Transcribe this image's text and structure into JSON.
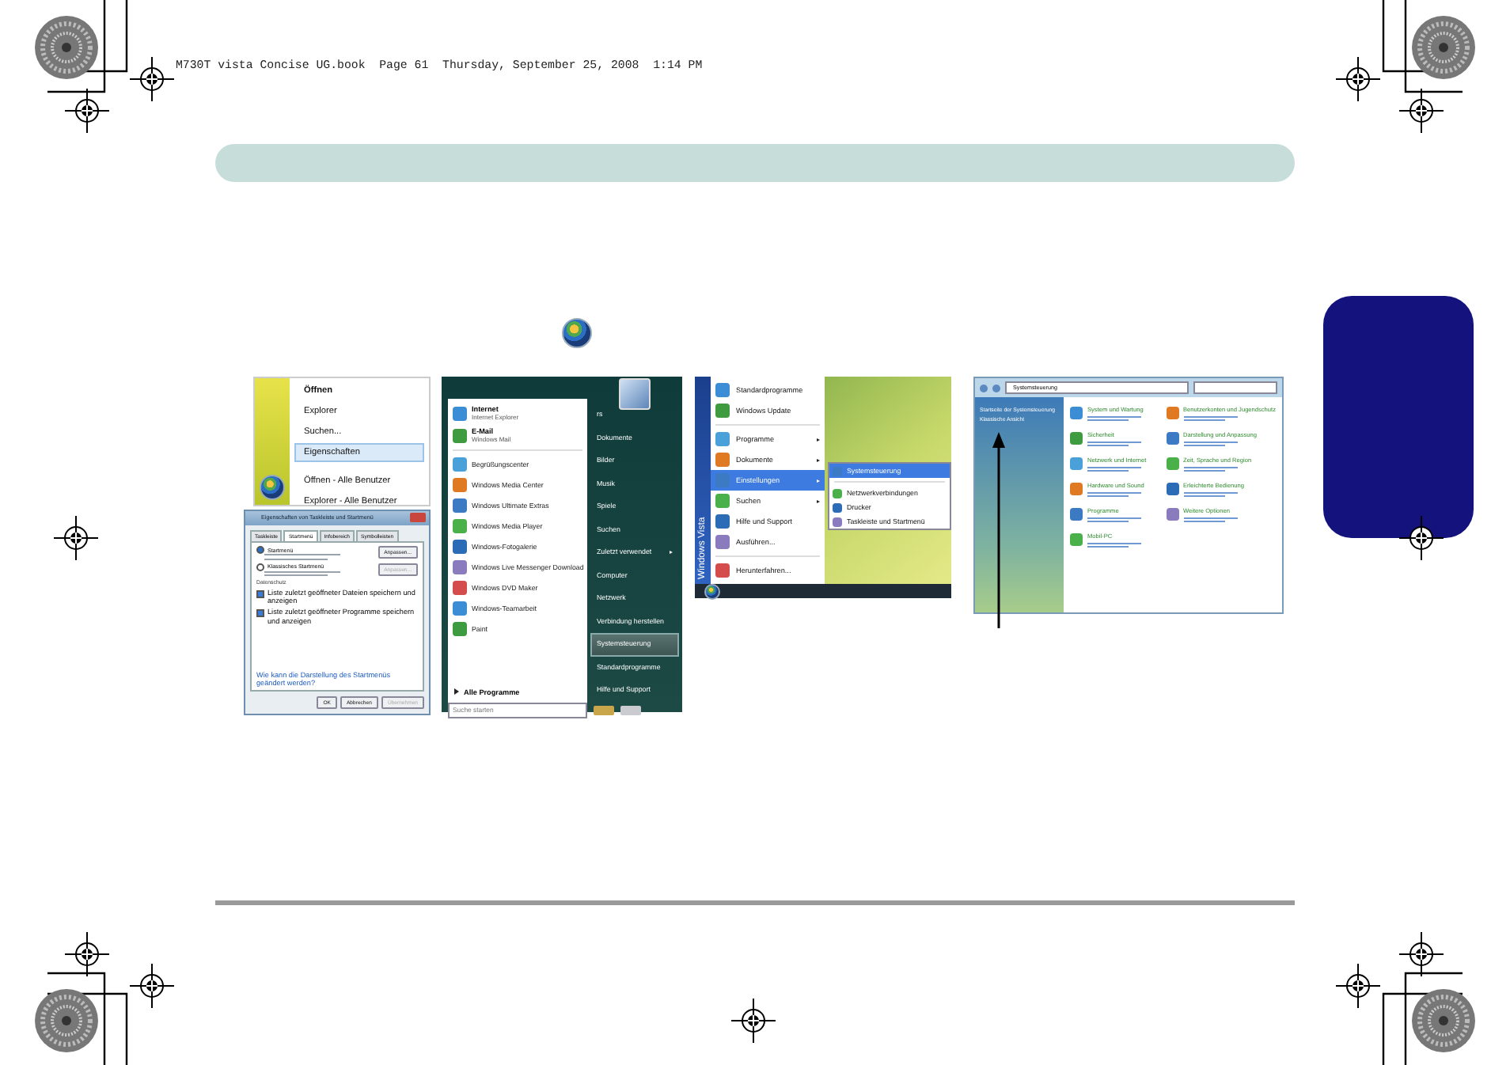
{
  "header": {
    "text": "M730T vista Concise UG.book  Page 61  Thursday, September 25, 2008  1:14 PM"
  },
  "context_menu": {
    "items": [
      {
        "label": "Öffnen",
        "bold": true,
        "selected": false
      },
      {
        "label": "Explorer",
        "bold": false,
        "selected": false
      },
      {
        "label": "Suchen...",
        "bold": false,
        "selected": false
      },
      {
        "label": "Eigenschaften",
        "bold": false,
        "selected": true
      },
      {
        "label": "Öffnen - Alle Benutzer",
        "bold": false,
        "selected": false
      },
      {
        "label": "Explorer - Alle Benutzer",
        "bold": false,
        "selected": false
      }
    ]
  },
  "properties_dialog": {
    "title": "Eigenschaften von Taskleiste und Startmenü",
    "tabs": [
      {
        "label": "Taskleiste",
        "selected": false
      },
      {
        "label": "Startmenü",
        "selected": true
      },
      {
        "label": "Infobereich",
        "selected": false
      },
      {
        "label": "Symbolleisten",
        "selected": false
      }
    ],
    "options": [
      {
        "label": "Startmenü",
        "selected": true,
        "button": "Anpassen...",
        "disabled": false
      },
      {
        "label": "Klassisches Startmenü",
        "selected": false,
        "button": "Anpassen...",
        "disabled": true
      }
    ],
    "privacy": {
      "label": "Datenschutz",
      "checks": [
        {
          "label": "Liste zuletzt geöffneter Dateien speichern und anzeigen",
          "checked": true
        },
        {
          "label": "Liste zuletzt geöffneter Programme speichern und anzeigen",
          "checked": true
        }
      ]
    },
    "link": "Wie kann die Darstellung des Startmenüs geändert werden?",
    "buttons": [
      {
        "label": "OK",
        "disabled": false
      },
      {
        "label": "Abbrechen",
        "disabled": false
      },
      {
        "label": "Übernehmen",
        "disabled": true
      }
    ]
  },
  "start_menu": {
    "pinned": [
      {
        "title": "Internet",
        "subtitle": "Internet Explorer"
      },
      {
        "title": "E-Mail",
        "subtitle": "Windows Mail"
      }
    ],
    "programs": [
      "Begrüßungscenter",
      "Windows Media Center",
      "Windows Ultimate Extras",
      "Windows Media Player",
      "Windows-Fotogalerie",
      "Windows Live Messenger Download",
      "Windows DVD Maker",
      "Windows-Teamarbeit",
      "Paint"
    ],
    "all_programs": "Alle Programme",
    "search": {
      "placeholder": "Suche starten"
    },
    "places": [
      {
        "label": "rs",
        "submenu": false,
        "selected": false
      },
      {
        "label": "Dokumente",
        "submenu": false,
        "selected": false
      },
      {
        "label": "Bilder",
        "submenu": false,
        "selected": false
      },
      {
        "label": "Musik",
        "submenu": false,
        "selected": false
      },
      {
        "label": "Spiele",
        "submenu": false,
        "selected": false
      },
      {
        "label": "Suchen",
        "submenu": false,
        "selected": false
      },
      {
        "label": "Zuletzt verwendet",
        "submenu": true,
        "selected": false
      },
      {
        "label": "Computer",
        "submenu": false,
        "selected": false
      },
      {
        "label": "Netzwerk",
        "submenu": false,
        "selected": false
      },
      {
        "label": "Verbindung herstellen",
        "submenu": false,
        "selected": false
      },
      {
        "label": "Systemsteuerung",
        "submenu": false,
        "selected": true
      },
      {
        "label": "Standardprogramme",
        "submenu": false,
        "selected": false
      },
      {
        "label": "Hilfe und Support",
        "submenu": false,
        "selected": false
      }
    ]
  },
  "classic_menu": {
    "banner": "Windows Vista",
    "items": [
      {
        "label": "Standardprogramme",
        "submenu": false,
        "selected": false
      },
      {
        "label": "Windows Update",
        "submenu": false,
        "selected": false
      },
      {
        "label": "Programme",
        "submenu": true,
        "selected": false
      },
      {
        "label": "Dokumente",
        "submenu": true,
        "selected": false
      },
      {
        "label": "Einstellungen",
        "submenu": true,
        "selected": true
      },
      {
        "label": "Suchen",
        "submenu": true,
        "selected": false
      },
      {
        "label": "Hilfe und Support",
        "submenu": false,
        "selected": false
      },
      {
        "label": "Ausführen...",
        "submenu": false,
        "selected": false
      },
      {
        "label": "Herunterfahren...",
        "submenu": false,
        "selected": false
      }
    ],
    "submenu": [
      {
        "label": "Systemsteuerung",
        "selected": true
      },
      {
        "label": "Netzwerkverbindungen",
        "selected": false
      },
      {
        "label": "Drucker",
        "selected": false
      },
      {
        "label": "Taskleiste und Startmenü",
        "selected": false
      }
    ]
  },
  "control_panel": {
    "address": "Systemsteuerung",
    "sidebar": [
      "Startseite der Systemsteuerung",
      "Klassische Ansicht"
    ],
    "columns": [
      [
        "System und Wartung",
        "Sicherheit",
        "Netzwerk und Internet",
        "Hardware und Sound",
        "Programme",
        "Mobil-PC"
      ],
      [
        "Benutzerkonten und Jugendschutz",
        "Darstellung und Anpassung",
        "Zeit, Sprache und Region",
        "Erleichterte Bedienung",
        "Weitere Optionen"
      ]
    ]
  }
}
